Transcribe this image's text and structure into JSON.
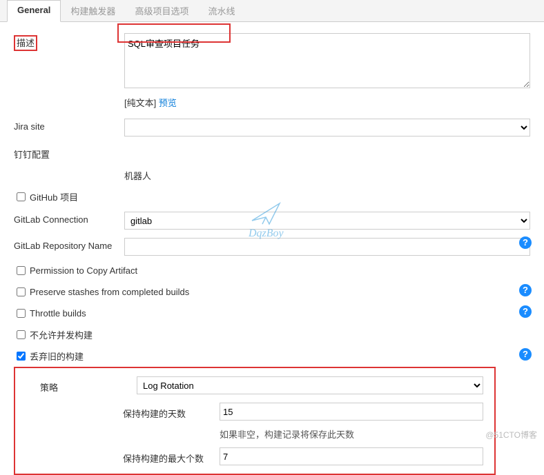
{
  "tabs": {
    "general": "General",
    "trigger": "构建触发器",
    "advanced": "高级项目选项",
    "pipeline": "流水线"
  },
  "desc": {
    "label": "描述",
    "value": "SQL审查项目任务",
    "plain": "[纯文本] ",
    "preview": "预览"
  },
  "jira": {
    "label": "Jira site"
  },
  "ding": {
    "label": "钉钉配置",
    "robot": "机器人"
  },
  "github": {
    "label": "GitHub 项目"
  },
  "gitlab": {
    "conn_label": "GitLab Connection",
    "conn_value": "gitlab",
    "repo_label": "GitLab Repository Name"
  },
  "perm": {
    "label": "Permission to Copy Artifact"
  },
  "stash": {
    "label": "Preserve stashes from completed builds"
  },
  "throttle": {
    "label": "Throttle builds"
  },
  "concurrent": {
    "label": "不允许并发构建"
  },
  "discard": {
    "label": "丢弃旧的构建",
    "strategy_label": "策略",
    "strategy_value": "Log Rotation",
    "days_label": "保持构建的天数",
    "days_value": "15",
    "days_help": "如果非空，构建记录将保存此天数",
    "max_label": "保持构建的最大个数",
    "max_value": "7"
  },
  "watermark": "DqzBoy",
  "footer": "@51CTO博客"
}
